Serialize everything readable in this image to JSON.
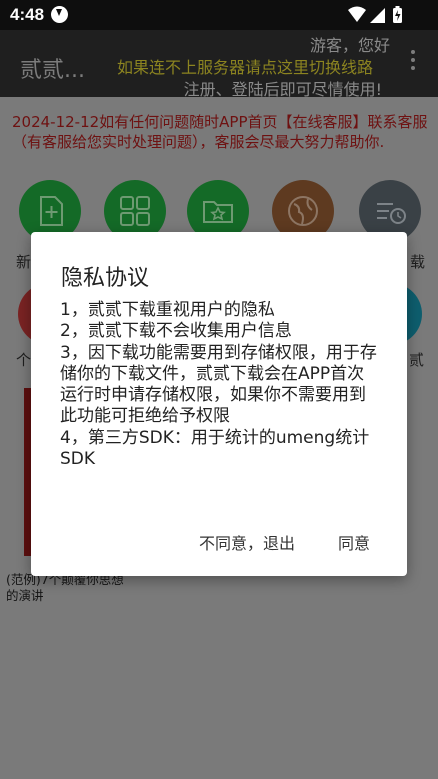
{
  "status_bar": {
    "time": "4:48"
  },
  "toolbar": {
    "app_title": "贰贰...",
    "greeting": "游客，您好",
    "switch_line": "如果连不上服务器请点这里切换线路",
    "register_note": "注册、登陆后即可尽情使用!"
  },
  "main": {
    "notice": "2024-12-12如有任何问题随时APP首页【在线客服】联系客服（有客服给您实时处理问题），客服会尽最大努力帮助你.",
    "grid_labels": {
      "new_partial": "新",
      "download_partial": "载",
      "personal_partial": "个",
      "row2_right_partial": "贰"
    },
    "video_caption": "(范例)7个颠覆你思想的演讲"
  },
  "dialog": {
    "title": "隐私协议",
    "lines": [
      "1，贰贰下载重视用户的隐私",
      "2，贰贰下载不会收集用户信息",
      "3，因下载功能需要用到存储权限，用于存储你的下载文件，贰贰下载会在APP首次运行时申请存储权限，如果你不需要用到此功能可拒绝给予权限",
      "4，第三方SDK：用于统计的umeng统计SDK"
    ],
    "decline_label": "不同意，退出",
    "agree_label": "同意"
  },
  "colors": {
    "overlay": "#7a7a7a",
    "toolbar": "#1f1f1f",
    "notice_text": "#6e1111",
    "green_icons": "#146a27",
    "brown_icon": "#5e3a20",
    "gray_icon": "#3a4146",
    "red_icon": "#7a2323",
    "teal_icon": "#0e5e6e"
  },
  "icons": [
    "download-status-icon",
    "wifi-icon",
    "signal-icon",
    "battery-icon",
    "overflow-menu-icon",
    "new-file-icon",
    "grid-apps-icon",
    "favorite-folder-icon",
    "globe-icon",
    "history-icon"
  ]
}
